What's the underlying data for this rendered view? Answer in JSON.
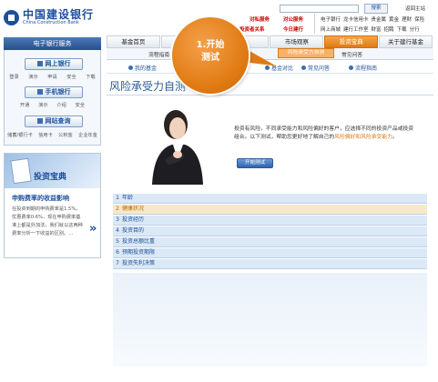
{
  "header": {
    "logo_cn": "中国建设银行",
    "logo_en": "China Construction Bank",
    "search_button": "搜索",
    "home_link": "返回主站",
    "links_red": [
      "对私服务",
      "对公服务",
      "投资者关系",
      "今日建行"
    ],
    "links_row1": [
      "电子银行",
      "龙卡信用卡",
      "贵金属",
      "黄金",
      "理财",
      "保险"
    ],
    "links_row2": [
      "网上商城",
      "建行工作室",
      "财富",
      "招聘",
      "下载",
      "分行"
    ]
  },
  "left": {
    "title": "电子银行服务",
    "buttons": [
      {
        "label": "网上银行",
        "subs": [
          "登录",
          "演示",
          "申请",
          "安全",
          "下载"
        ]
      },
      {
        "label": "手机银行",
        "subs": [
          "开通",
          "演示",
          "介绍",
          "安全"
        ]
      },
      {
        "label": "网站查询",
        "subs": [
          "储蓄/银行卡",
          "信用卡",
          "公积金",
          "企业年金"
        ]
      }
    ],
    "promo": {
      "banner": "投资宝典",
      "title": "申购费率的收益影响",
      "text": "在投资到期的申购费率是1.5%，优惠费率0.6%，现在申购费率基准上都是外加法，我们就以这两种费率分析一下收益的区别。...",
      "arrow": "»"
    }
  },
  "nav": {
    "tabs": [
      "基金首页",
      "",
      "",
      "市场观察",
      "投资宝典",
      "关于建行基金"
    ],
    "active_index": 4,
    "sub": [
      "流程指南",
      "",
      "",
      "",
      "风险承受力自测",
      "常见问答"
    ],
    "sub2": [
      "我的基金",
      "",
      "",
      "基金对比",
      "常见问答",
      "流程指南"
    ]
  },
  "page_title": "风险承受力自测",
  "callout": {
    "line1": "1.开始",
    "line2": "测试"
  },
  "intro": {
    "text": "投资有风险，不同承受能力和风险偏好的客户，应选择不同的投资产品或投资组合。以下测试，帮助您更好地了解自己的",
    "link": "风险偏好和风险承受能力",
    "end": "。",
    "button": "开始测试"
  },
  "questions": [
    {
      "n": "1",
      "label": "年龄"
    },
    {
      "n": "2",
      "label": "健康状况"
    },
    {
      "n": "3",
      "label": "投资经历"
    },
    {
      "n": "4",
      "label": "投资目的"
    },
    {
      "n": "5",
      "label": "投资总额比重"
    },
    {
      "n": "6",
      "label": "预期投资期限"
    },
    {
      "n": "7",
      "label": "投资失利决策"
    }
  ],
  "active_question": 2,
  "colors": {
    "brand": "#1c4f9c",
    "accent": "#e07a12"
  }
}
